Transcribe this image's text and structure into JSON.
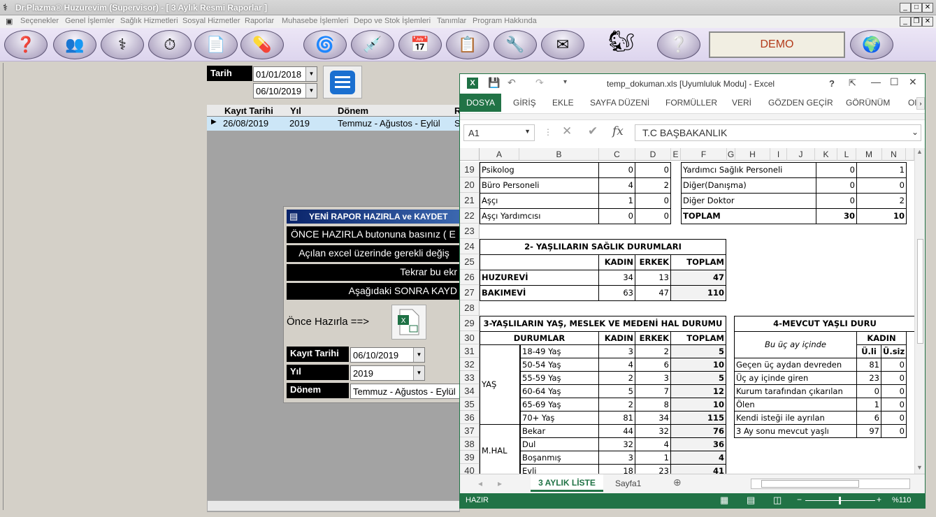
{
  "app": {
    "title": "Dr.Plazma® Huzurevim (Supervisor) - [ 3 Aylık Resmi Raporlar ]",
    "menu": [
      "Seçenekler",
      "Genel İşlemler",
      "Sağlık Hizmetleri",
      "Sosyal Hizmetler",
      "Raporlar",
      "Muhasebe İşlemleri",
      "Depo ve Stok İşlemleri",
      "Tanımlar",
      "Program Hakkında"
    ],
    "demo": "DEMO"
  },
  "filter": {
    "tarih_label": "Tarih",
    "date_from": "01/01/2018",
    "date_to": "06/10/2019"
  },
  "grid": {
    "headers": [
      "Kayıt Tarihi",
      "Yıl",
      "Dönem",
      "R"
    ],
    "row": [
      "26/08/2019",
      "2019",
      "Temmuz - Ağustos - Eylül",
      "S"
    ]
  },
  "dialog": {
    "title": "YENİ RAPOR HAZIRLA ve KAYDET",
    "lines": [
      "ÖNCE HAZIRLA butonuna basınız ( E",
      "Açılan excel üzerinde gerekli değiş",
      "Tekrar bu ekr",
      "Aşağıdaki SONRA KAYD"
    ],
    "prepare_label": "Önce Hazırla ==>",
    "kayit_label": "Kayıt Tarihi",
    "kayit_value": "06/10/2019",
    "yil_label": "Yıl",
    "yil_value": "2019",
    "donem_label": "Dönem",
    "donem_value": "Temmuz - Ağustos - Eylül"
  },
  "excel": {
    "title": "temp_dokuman.xls  [Uyumluluk Modu] - Excel",
    "help": "?",
    "tabs": [
      "DOSYA",
      "GİRİŞ",
      "EKLE",
      "SAYFA DÜZENİ",
      "FORMÜLLER",
      "VERİ",
      "GÖZDEN GEÇİR",
      "GÖRÜNÜM",
      "Ol"
    ],
    "namebox": "A1",
    "formula": "T.C BAŞBAKANLIK",
    "cols": [
      "A",
      "B",
      "C",
      "D",
      "E",
      "F",
      "G",
      "H",
      "I",
      "J",
      "K",
      "L",
      "M",
      "N"
    ],
    "rows": [
      "19",
      "20",
      "21",
      "22",
      "23",
      "24",
      "25",
      "26",
      "27",
      "28",
      "29",
      "30",
      "31",
      "32",
      "33",
      "34",
      "35",
      "36",
      "37",
      "38",
      "39",
      "40"
    ],
    "staff": [
      [
        "Psikolog",
        "0",
        "0",
        "Yardımcı Sağlık Personeli",
        "0",
        "1"
      ],
      [
        "Büro Personeli",
        "4",
        "2",
        "Diğer(Danışma)",
        "0",
        "0"
      ],
      [
        "Aşçı",
        "1",
        "0",
        "Diğer Doktor",
        "0",
        "2"
      ],
      [
        "Aşçı Yardımcısı",
        "0",
        "0",
        "TOPLAM",
        "30",
        "10"
      ]
    ],
    "health": {
      "title": "2- YAŞLILARIN SAĞLIK DURUMLARI",
      "headers": [
        "KADIN",
        "ERKEK",
        "TOPLAM"
      ],
      "rows": [
        [
          "HUZUREVİ",
          "34",
          "13",
          "47"
        ],
        [
          "BAKIMEVİ",
          "63",
          "47",
          "110"
        ]
      ]
    },
    "age": {
      "title": "3-YAŞLILARIN YAŞ, MESLEK VE MEDENİ  HAL DURUMU",
      "headers": [
        "DURUMLAR",
        "KADIN",
        "ERKEK",
        "TOPLAM"
      ],
      "group1": "YAŞ",
      "group2": "M.HAL",
      "rows": [
        [
          "18-49 Yaş",
          "3",
          "2",
          "5"
        ],
        [
          "50-54 Yaş",
          "4",
          "6",
          "10"
        ],
        [
          "55-59 Yaş",
          "2",
          "3",
          "5"
        ],
        [
          "60-64  Yaş",
          "5",
          "7",
          "12"
        ],
        [
          "65-69 Yaş",
          "2",
          "8",
          "10"
        ],
        [
          "70+ Yaş",
          "81",
          "34",
          "115"
        ],
        [
          "Bekar",
          "44",
          "32",
          "76"
        ],
        [
          "Dul",
          "32",
          "4",
          "36"
        ],
        [
          "Boşanmış",
          "3",
          "1",
          "4"
        ],
        [
          "Evli",
          "18",
          "23",
          "41"
        ]
      ]
    },
    "mevcut": {
      "title": "4-MEVCUT YAŞLI DURU",
      "sub": "Bu üç ay içinde",
      "kadin": "KADIN",
      "h1": "Ü.li",
      "h2": "Ü.siz",
      "rows": [
        [
          "Geçen üç aydan devreden",
          "81",
          "0"
        ],
        [
          "Üç ay içinde giren",
          "23",
          "0"
        ],
        [
          "Kurum tarafından çıkarılan",
          "0",
          "0"
        ],
        [
          "Ölen",
          "1",
          "0"
        ],
        [
          "Kendi isteği ile ayrılan",
          "6",
          "0"
        ],
        [
          "3 Ay sonu mevcut yaşlı",
          "97",
          "0"
        ]
      ]
    },
    "sheet_tabs": [
      "3 AYLIK LİSTE",
      "Sayfa1"
    ],
    "status": "HAZIR",
    "zoom": "%110"
  }
}
